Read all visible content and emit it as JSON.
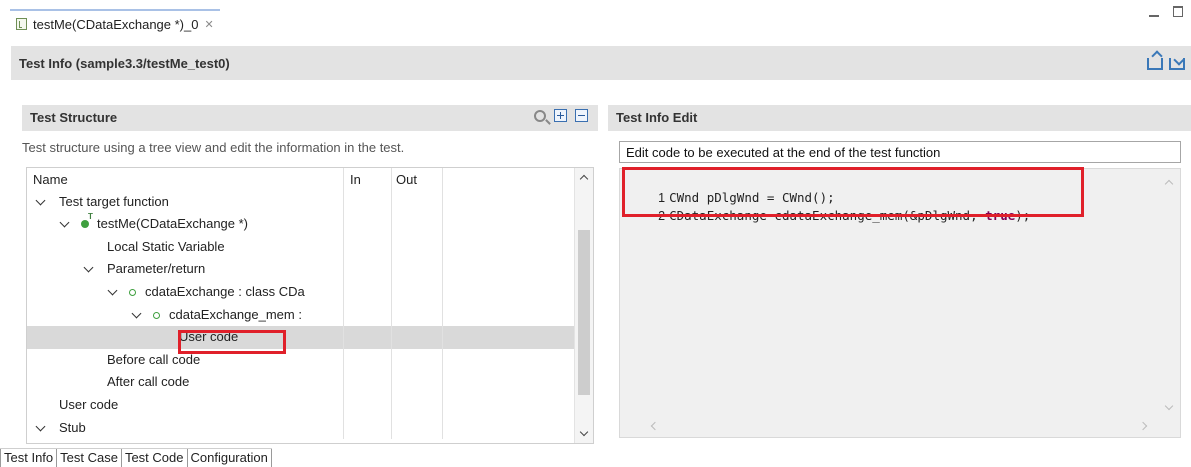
{
  "editor_tab": {
    "title": "testMe(CDataExchange *)_0",
    "close_glyph": "✕"
  },
  "title_bar": {
    "title": "Test Info (sample3.3/testMe_test0)"
  },
  "test_structure": {
    "header": "Test Structure",
    "description": "Test structure using a tree view and edit the information in the test.",
    "columns": {
      "name": "Name",
      "in": "In",
      "out": "Out"
    },
    "rows": [
      {
        "label": "Test target function",
        "level": 0,
        "expander": true,
        "icon": ""
      },
      {
        "label": "testMe(CDataExchange *)",
        "level": 1,
        "expander": true,
        "icon": "method-icon"
      },
      {
        "label": "Local Static Variable",
        "level": 2,
        "expander": false,
        "icon": ""
      },
      {
        "label": "Parameter/return",
        "level": 2,
        "expander": true,
        "icon": ""
      },
      {
        "label": "cdataExchange : class CDa",
        "level": 3,
        "expander": true,
        "icon": "field-icon"
      },
      {
        "label": "cdataExchange_mem :",
        "level": 4,
        "expander": true,
        "icon": "field-icon"
      },
      {
        "label": "User code",
        "level": 5,
        "expander": false,
        "icon": "",
        "selected": true
      },
      {
        "label": "Before call code",
        "level": 2,
        "expander": false,
        "icon": ""
      },
      {
        "label": "After call code",
        "level": 2,
        "expander": false,
        "icon": ""
      },
      {
        "label": "User code",
        "level": 0,
        "expander": false,
        "icon": ""
      },
      {
        "label": "Stub",
        "level": 0,
        "expander": true,
        "icon": ""
      }
    ]
  },
  "test_info_edit": {
    "header": "Test Info Edit",
    "caption": "Edit code to be executed at the end of the test function",
    "code_lines": [
      {
        "num": "1",
        "before": "CWnd pDlgWnd = CWnd();",
        "keyword": "",
        "after": ""
      },
      {
        "num": "2",
        "before": "CDataExchange cdataExchange_mem(&pDlgWnd, ",
        "keyword": "true",
        "after": ");"
      }
    ]
  },
  "bottom_tabs": [
    "Test Info",
    "Test Case",
    "Test Code",
    "Configuration"
  ],
  "colors": {
    "highlight": "#e0202a",
    "keyword": "#7f0055",
    "header_bg": "#e3e3e3"
  }
}
